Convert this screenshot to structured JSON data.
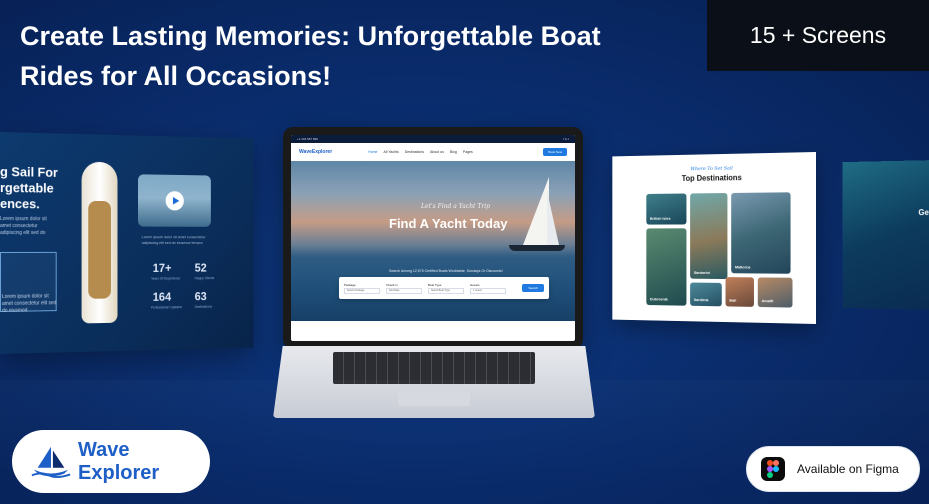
{
  "headline": "Create Lasting Memories: Unforgettable Boat Rides for All Occasions!",
  "screens_badge": "15 + Screens",
  "brand": {
    "name": "Wave Explorer"
  },
  "figma": {
    "label": "Available on Figma"
  },
  "left_panel": {
    "title": "g Sail For\nrgettable\nences.",
    "stats": [
      {
        "value": "17+",
        "label": "Years Of Experience"
      },
      {
        "value": "52",
        "label": "Happy Clients"
      },
      {
        "value": "164",
        "label": "Professional Captains"
      },
      {
        "value": "63",
        "label": "Destinations"
      }
    ]
  },
  "laptop_site": {
    "logo": "WaveExplorer",
    "nav": [
      "Home",
      "All Yachts",
      "Destinations",
      "About us",
      "Blog",
      "Pages"
    ],
    "nav_button": "Book Now",
    "hero_script": "Let's Find a Yacht Trip",
    "hero_title": "Find A Yacht Today",
    "hero_sub": "Search Among 12,575 Certified Boats Worldwide, Sundays Or Discounts!",
    "search": [
      {
        "label": "Package",
        "value": "Select Package"
      },
      {
        "label": "Check in",
        "value": "Add Date"
      },
      {
        "label": "Boat Type",
        "value": "Select Boat Type"
      },
      {
        "label": "Guests",
        "value": "1 Guest"
      }
    ],
    "search_button": "Search"
  },
  "destinations_panel": {
    "script": "Where To Set Sail",
    "title": "Top Destinations",
    "tiles": [
      "British Isles",
      "Santorini",
      "Mallorca",
      "Dubrovnik",
      "Sardinia",
      "Bali",
      "Amalfi"
    ]
  },
  "right_panel": {
    "title": "Get"
  },
  "colors": {
    "accent": "#1e7ae0",
    "background": "#0a2d6e",
    "badge_bg": "#0b0f17"
  }
}
